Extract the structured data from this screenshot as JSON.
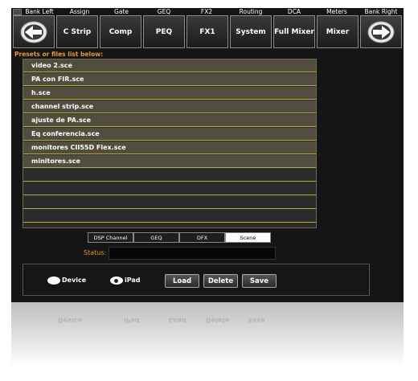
{
  "top_labels": [
    "Bank Left",
    "Assign",
    "Gate",
    "GEQ",
    "FX2",
    "Routing",
    "DCA",
    "Meters",
    "Bank Right"
  ],
  "top_buttons": {
    "bank_left_icon": "arrow-left-icon",
    "c_strip": "C Strip",
    "comp": "Comp",
    "peq": "PEQ",
    "fx1": "FX1",
    "system": "System",
    "full_mixer": "Full Mixer",
    "mixer": "Mixer",
    "bank_right_icon": "arrow-right-icon"
  },
  "presets_label": "Presets or files list below:",
  "files": [
    "video 2.sce",
    "PA con FIR.sce",
    "h.sce",
    "channel strip.sce",
    "ajuste de PA.sce",
    "Eq conferencia.sce",
    "monitores CII55D Flex.sce",
    "minitores.sce"
  ],
  "tabs": {
    "dsp_channel": "DSP Channel",
    "geq": "GEQ",
    "dfx": "DFX",
    "scene": "Scene",
    "active": "Scene"
  },
  "status": {
    "label": "Status:",
    "value": ""
  },
  "storage": {
    "device": "Device",
    "ipad": "iPad",
    "selected": "iPad"
  },
  "actions": {
    "load": "Load",
    "delete": "Delete",
    "save": "Save"
  },
  "colors": {
    "accent_orange": "#e89a2a",
    "list_line": "#b9a93a",
    "row_fill": "#514e3f"
  }
}
